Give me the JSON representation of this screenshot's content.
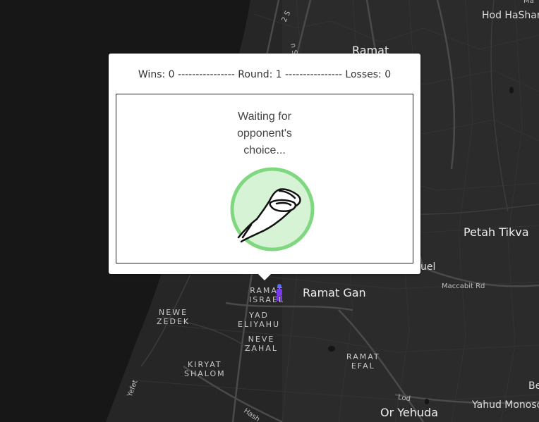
{
  "map": {
    "labels": {
      "hod_hasharon": "Hod HaShar",
      "ramat_top": "Ramat",
      "petah_tikva": "Petah Tikva",
      "ramat_gan": "Ramat Gan",
      "or_yehuda": "Or Yehuda",
      "yahud": "Yahud Monoso",
      "kfar_ganim": "Ma",
      "ramat_israel": "RAMAT\nISRAEL",
      "yad_eliyahu": "YAD\nELIYAHU",
      "neve_zahal": "NEVE\nZAHAL",
      "neve_zedek": "NEWE\nZEDEK",
      "kiryat_shalom": "KIRYAT\nSHALOM",
      "ramat_efal": "RAMAT\nEFAL",
      "samuel": "uel",
      "be": "Be"
    },
    "roads": {
      "maccabit": "Maccabit Rd",
      "lod": "Lod",
      "yefet": "Yefet",
      "hash": "Hash",
      "road_2s": "2 S",
      "road_ns": "n S"
    }
  },
  "game": {
    "wins_label": "Wins: 0",
    "round_label": "Round: 1",
    "losses_label": "Losses: 0",
    "separator": "----------------",
    "waiting_lines": [
      "Waiting for",
      "opponent's",
      "choice..."
    ],
    "choice_icon": "ok-hand-icon",
    "choice_ring_color": "#7fd87f",
    "choice_fill_color": "#d6f3d6"
  }
}
